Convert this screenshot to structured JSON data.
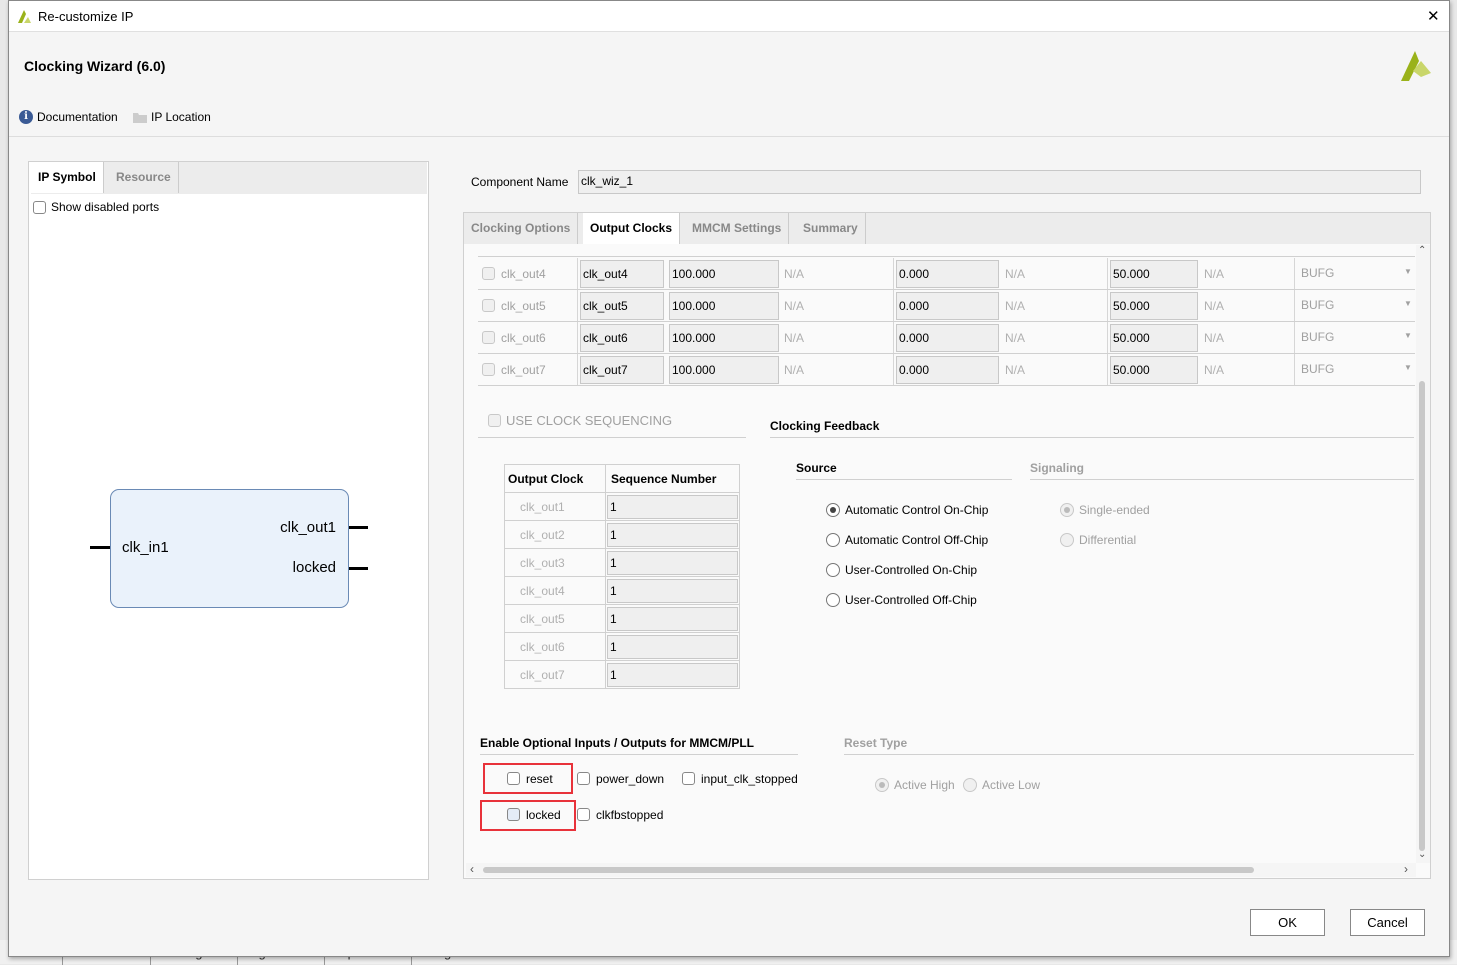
{
  "background_tabs": [
    "Tcl Console",
    "Messages",
    "Log",
    "Reports",
    "Design Runs"
  ],
  "window": {
    "title": "Re-customize IP",
    "close": "✕"
  },
  "header": {
    "title": "Clocking Wizard (6.0)",
    "documentation": "Documentation",
    "ip_location": "IP Location"
  },
  "left": {
    "tabs": [
      {
        "label": "IP Symbol",
        "active": true
      },
      {
        "label": "Resource",
        "active": false
      }
    ],
    "show_disabled_ports": "Show disabled ports",
    "symbol": {
      "input": "clk_in1",
      "outputs": [
        "clk_out1",
        "locked"
      ]
    }
  },
  "component": {
    "label": "Component Name",
    "value": "clk_wiz_1"
  },
  "tabs": [
    {
      "label": "Clocking Options",
      "active": false
    },
    {
      "label": "Output Clocks",
      "active": true
    },
    {
      "label": "MMCM Settings",
      "active": false
    },
    {
      "label": "Summary",
      "active": false
    }
  ],
  "output_clocks": [
    {
      "name": "clk_out4",
      "port": "clk_out4",
      "freq": "100.000",
      "freq_actual": "N/A",
      "phase": "0.000",
      "phase_actual": "N/A",
      "duty": "50.000",
      "duty_actual": "N/A",
      "driver": "BUFG"
    },
    {
      "name": "clk_out5",
      "port": "clk_out5",
      "freq": "100.000",
      "freq_actual": "N/A",
      "phase": "0.000",
      "phase_actual": "N/A",
      "duty": "50.000",
      "duty_actual": "N/A",
      "driver": "BUFG"
    },
    {
      "name": "clk_out6",
      "port": "clk_out6",
      "freq": "100.000",
      "freq_actual": "N/A",
      "phase": "0.000",
      "phase_actual": "N/A",
      "duty": "50.000",
      "duty_actual": "N/A",
      "driver": "BUFG"
    },
    {
      "name": "clk_out7",
      "port": "clk_out7",
      "freq": "100.000",
      "freq_actual": "N/A",
      "phase": "0.000",
      "phase_actual": "N/A",
      "duty": "50.000",
      "duty_actual": "N/A",
      "driver": "BUFG"
    }
  ],
  "sequencing": {
    "label": "USE CLOCK SEQUENCING",
    "headers": [
      "Output Clock",
      "Sequence Number"
    ],
    "rows": [
      [
        "clk_out1",
        "1"
      ],
      [
        "clk_out2",
        "1"
      ],
      [
        "clk_out3",
        "1"
      ],
      [
        "clk_out4",
        "1"
      ],
      [
        "clk_out5",
        "1"
      ],
      [
        "clk_out6",
        "1"
      ],
      [
        "clk_out7",
        "1"
      ]
    ]
  },
  "feedback": {
    "title": "Clocking Feedback",
    "source_label": "Source",
    "signaling_label": "Signaling",
    "source_options": [
      {
        "label": "Automatic Control On-Chip",
        "selected": true
      },
      {
        "label": "Automatic Control Off-Chip",
        "selected": false
      },
      {
        "label": "User-Controlled On-Chip",
        "selected": false
      },
      {
        "label": "User-Controlled Off-Chip",
        "selected": false
      }
    ],
    "signaling_options": [
      {
        "label": "Single-ended",
        "selected": true
      },
      {
        "label": "Differential",
        "selected": false
      }
    ]
  },
  "optional": {
    "title": "Enable Optional Inputs / Outputs for MMCM/PLL",
    "items": [
      {
        "label": "reset",
        "checked": false
      },
      {
        "label": "power_down",
        "checked": false
      },
      {
        "label": "input_clk_stopped",
        "checked": false
      },
      {
        "label": "locked",
        "checked": false
      },
      {
        "label": "clkfbstopped",
        "checked": false
      }
    ]
  },
  "reset_type": {
    "title": "Reset Type",
    "options": [
      {
        "label": "Active High",
        "selected": true
      },
      {
        "label": "Active Low",
        "selected": false
      }
    ]
  },
  "buttons": {
    "ok": "OK",
    "cancel": "Cancel"
  },
  "colors": {
    "highlight": "#e8323a",
    "symbol_fill": "#eaf2fb",
    "logo": "#9ab21a"
  }
}
